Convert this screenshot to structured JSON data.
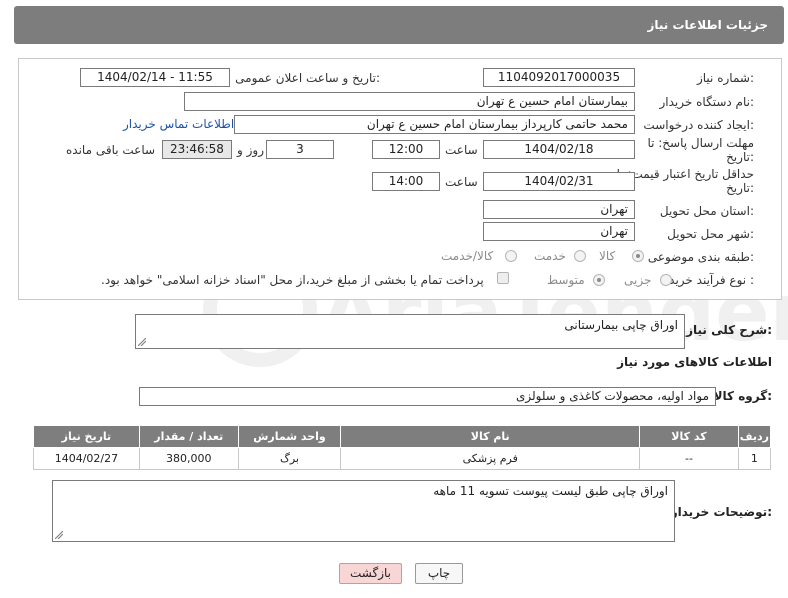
{
  "header": {
    "title": "جزئیات اطلاعات نیاز"
  },
  "fields": {
    "need_number_label": "شماره نیاز:",
    "need_number": "1104092017000035",
    "announce_label": "تاریخ و ساعت اعلان عمومی:",
    "announce_value": "1404/02/14 - 11:55",
    "buyer_org_label": "نام دستگاه خریدار:",
    "buyer_org": "بیمارستان امام حسین  ع  تهران",
    "creator_label": "ایجاد کننده درخواست:",
    "creator": "محمد حاتمی کارپرداز بیمارستان امام حسین  ع  تهران",
    "contact_link": "اطلاعات تماس خریدار",
    "reply_deadline_label": "مهلت ارسال پاسخ: تا تاریخ:",
    "reply_date": "1404/02/18",
    "time_label": "ساعت",
    "reply_time": "12:00",
    "days_value": "3",
    "days_label": "روز و",
    "remaining_time": "23:46:58",
    "remaining_label": "ساعت باقی مانده",
    "price_validity_label": "حداقل تاریخ اعتبار قیمت: تا تاریخ:",
    "price_date": "1404/02/31",
    "price_time": "14:00",
    "province_label": "استان محل تحویل:",
    "province": "تهران",
    "city_label": "شهر محل تحویل:",
    "city": "تهران",
    "category_label": "طبقه بندی موضوعی:",
    "category_options": [
      "کالا",
      "خدمت",
      "کالا/خدمت"
    ],
    "purchase_type_label": "نوع فرآیند خرید :",
    "purchase_options": [
      "جزیی",
      "متوسط"
    ],
    "payment_note": "پرداخت تمام یا بخشی از مبلغ خرید،از محل \"اسناد خزانه اسلامی\" خواهد بود."
  },
  "summary": {
    "label": "شرح کلی نیاز:",
    "value": "اوراق چاپی بیمارستانی"
  },
  "goods_section": {
    "title": "اطلاعات کالاهای مورد نیاز",
    "group_label": "گروه کالا:",
    "group_value": "مواد اولیه، محصولات کاغذی و سلولزی"
  },
  "table": {
    "columns": [
      "ردیف",
      "کد کالا",
      "نام کالا",
      "واحد شمارش",
      "تعداد / مقدار",
      "تاریخ نیاز"
    ],
    "rows": [
      [
        "1",
        "--",
        "فرم پزشکی",
        "برگ",
        "380,000",
        "1404/02/27"
      ]
    ]
  },
  "buyer_notes": {
    "label": "توضیحات خریدار:",
    "value": "اوراق چاپی طبق لیست پیوست تسویه 11 ماهه"
  },
  "buttons": {
    "print": "چاپ",
    "back": "بازگشت"
  },
  "watermark": {
    "text": "AriaTender.neT"
  }
}
